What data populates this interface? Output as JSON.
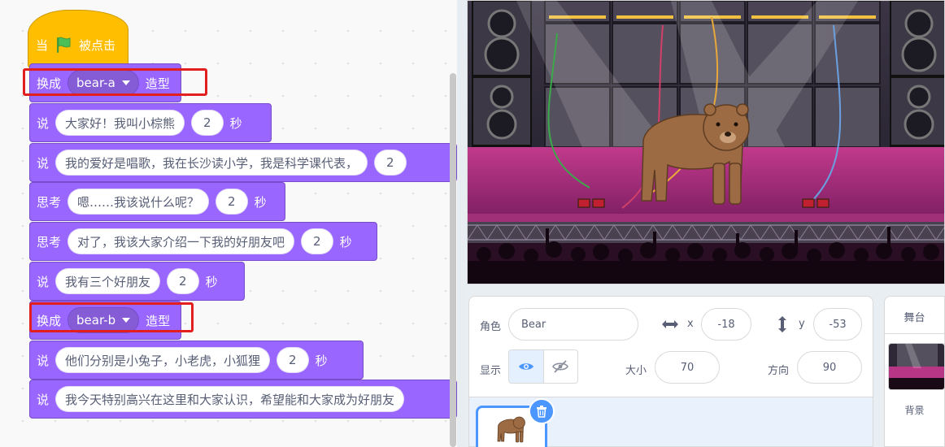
{
  "script": {
    "hat": {
      "prefix": "当",
      "suffix": "被点击",
      "icon": "green-flag-icon"
    },
    "blocks": [
      {
        "op": "switch_costume",
        "label": "换成",
        "costume": "bear-a",
        "suffix": "造型",
        "highlighted": true
      },
      {
        "op": "say_for_secs",
        "label": "说",
        "text": "大家好！我叫小棕熊",
        "secs": "2",
        "suffix": "秒"
      },
      {
        "op": "say_for_secs",
        "label": "说",
        "text": "我的爱好是唱歌，我在长沙读小学，我是科学课代表，",
        "secs": "2"
      },
      {
        "op": "think_for_secs",
        "label": "思考",
        "text": "嗯……我该说什么呢？",
        "secs": "2",
        "suffix": "秒"
      },
      {
        "op": "think_for_secs",
        "label": "思考",
        "text": "对了，我该大家介绍一下我的好朋友吧",
        "secs": "2",
        "suffix": "秒"
      },
      {
        "op": "say_for_secs",
        "label": "说",
        "text": "我有三个好朋友",
        "secs": "2",
        "suffix": "秒"
      },
      {
        "op": "switch_costume",
        "label": "换成",
        "costume": "bear-b",
        "suffix": "造型",
        "highlighted": true
      },
      {
        "op": "say_for_secs",
        "label": "说",
        "text": "他们分别是小兔子，小老虎，小狐狸",
        "secs": "2",
        "suffix": "秒"
      },
      {
        "op": "say",
        "label": "说",
        "text": "我今天特别高兴在这里和大家认识，希望能和大家成为好朋友"
      }
    ]
  },
  "sprite_info": {
    "sprite_label": "角色",
    "sprite_name": "Bear",
    "x_label": "x",
    "x": "-18",
    "y_label": "y",
    "y": "-53",
    "show_label": "显示",
    "size_label": "大小",
    "size": "70",
    "direction_label": "方向",
    "direction": "90"
  },
  "stage_panel": {
    "title": "舞台",
    "backdrop_label": "背景"
  },
  "colors": {
    "looks": "#9966ff",
    "events": "#ffbf00",
    "highlight": "#e21e1e",
    "accent": "#4c97ff"
  }
}
